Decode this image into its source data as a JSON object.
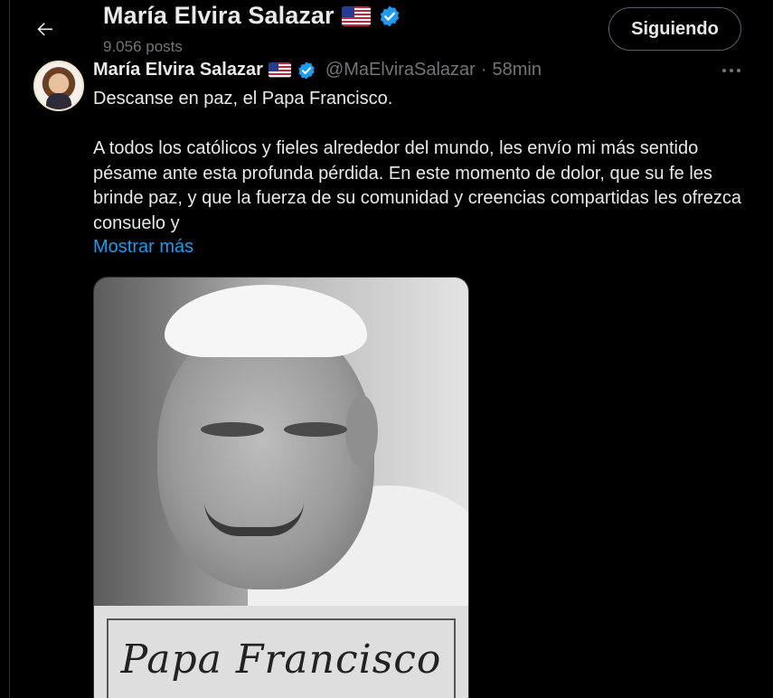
{
  "header": {
    "back_icon": "arrow-left-icon",
    "title": "María Elvira Salazar",
    "flag_icon": "us-flag-icon",
    "verified_icon": "verified-badge-icon",
    "post_count": "9.056 posts",
    "follow_label": "Siguiendo"
  },
  "tweet": {
    "author_name": "María Elvira Salazar",
    "handle": "@MaElviraSalazar",
    "separator": "·",
    "time": "58min",
    "more_icon": "more-horizontal-icon",
    "text_line_1": "Descanse en paz, el Papa Francisco.",
    "text_paragraph_2": "A todos los católicos y fieles alrededor del mundo, les envío mi más sentido pésame ante esta profunda pérdida. En este momento de dolor, que su fe les brinde paz, y que la fuerza de su comunidad y creencias compartidas les ofrezca consuelo y",
    "show_more": "Mostrar más",
    "media_caption": "Papa Francisco"
  },
  "colors": {
    "background": "#000000",
    "text": "#e7e9ea",
    "muted": "#71767b",
    "link": "#1d9bf0",
    "verified": "#1d9bf0",
    "border": "#2f3336"
  }
}
